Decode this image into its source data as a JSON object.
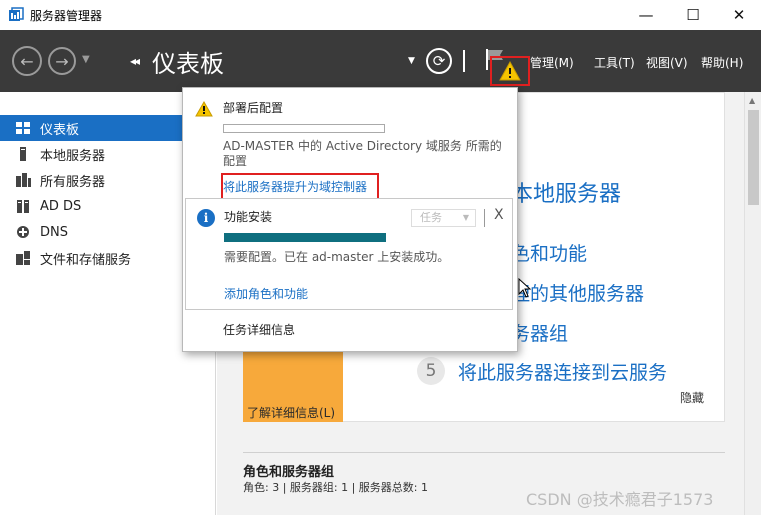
{
  "window": {
    "title": "服务器管理器",
    "controls": [
      "—",
      "☐",
      "✕"
    ]
  },
  "header": {
    "breadcrumb_chevron": "◂◂",
    "title": "仪表板",
    "menus": [
      "管理(M)",
      "工具(T)",
      "视图(V)",
      "帮助(H)"
    ]
  },
  "sidebar": {
    "items": [
      {
        "label": "仪表板",
        "icon": "dashboard-icon",
        "active": true
      },
      {
        "label": "本地服务器",
        "icon": "local-server-icon",
        "active": false
      },
      {
        "label": "所有服务器",
        "icon": "all-servers-icon",
        "active": false
      },
      {
        "label": "AD DS",
        "icon": "adds-icon",
        "active": false
      },
      {
        "label": "DNS",
        "icon": "dns-icon",
        "active": false
      },
      {
        "label": "文件和存储服务",
        "icon": "file-storage-icon",
        "active": false
      }
    ]
  },
  "main": {
    "links": {
      "local_server": "本地服务器",
      "roles": "色和功能",
      "other_servers": "理的其他服务器",
      "server_group": "务器组",
      "cloud_num": "5",
      "cloud": "将此服务器连接到云服务"
    },
    "learn_more": "了解详细信息(L)",
    "hide": "隐藏",
    "roles_section": {
      "title": "角色和服务器组",
      "subtitle": "角色: 3 | 服务器组: 1 | 服务器总数: 1"
    }
  },
  "notifications": {
    "post_deploy": {
      "title": "部署后配置",
      "description": "AD-MASTER 中的 Active Directory 域服务 所需的配置",
      "link": "将此服务器提升为域控制器"
    },
    "feature_install": {
      "title": "功能安装",
      "task_dropdown": "任务",
      "close": "X",
      "description": "需要配置。已在 ad-master 上安装成功。",
      "link": "添加角色和功能",
      "progress": 1.0
    },
    "task_details": "任务详细信息"
  },
  "watermark": "CSDN @技术瘾君子1573",
  "colors": {
    "accent": "#1a6fc4",
    "header_bg": "#3a3a3a",
    "highlight_red": "#e02020",
    "warning_yellow": "#f5c400",
    "progress_teal": "#0f6f7f",
    "orange_tile": "#f7a93b"
  }
}
